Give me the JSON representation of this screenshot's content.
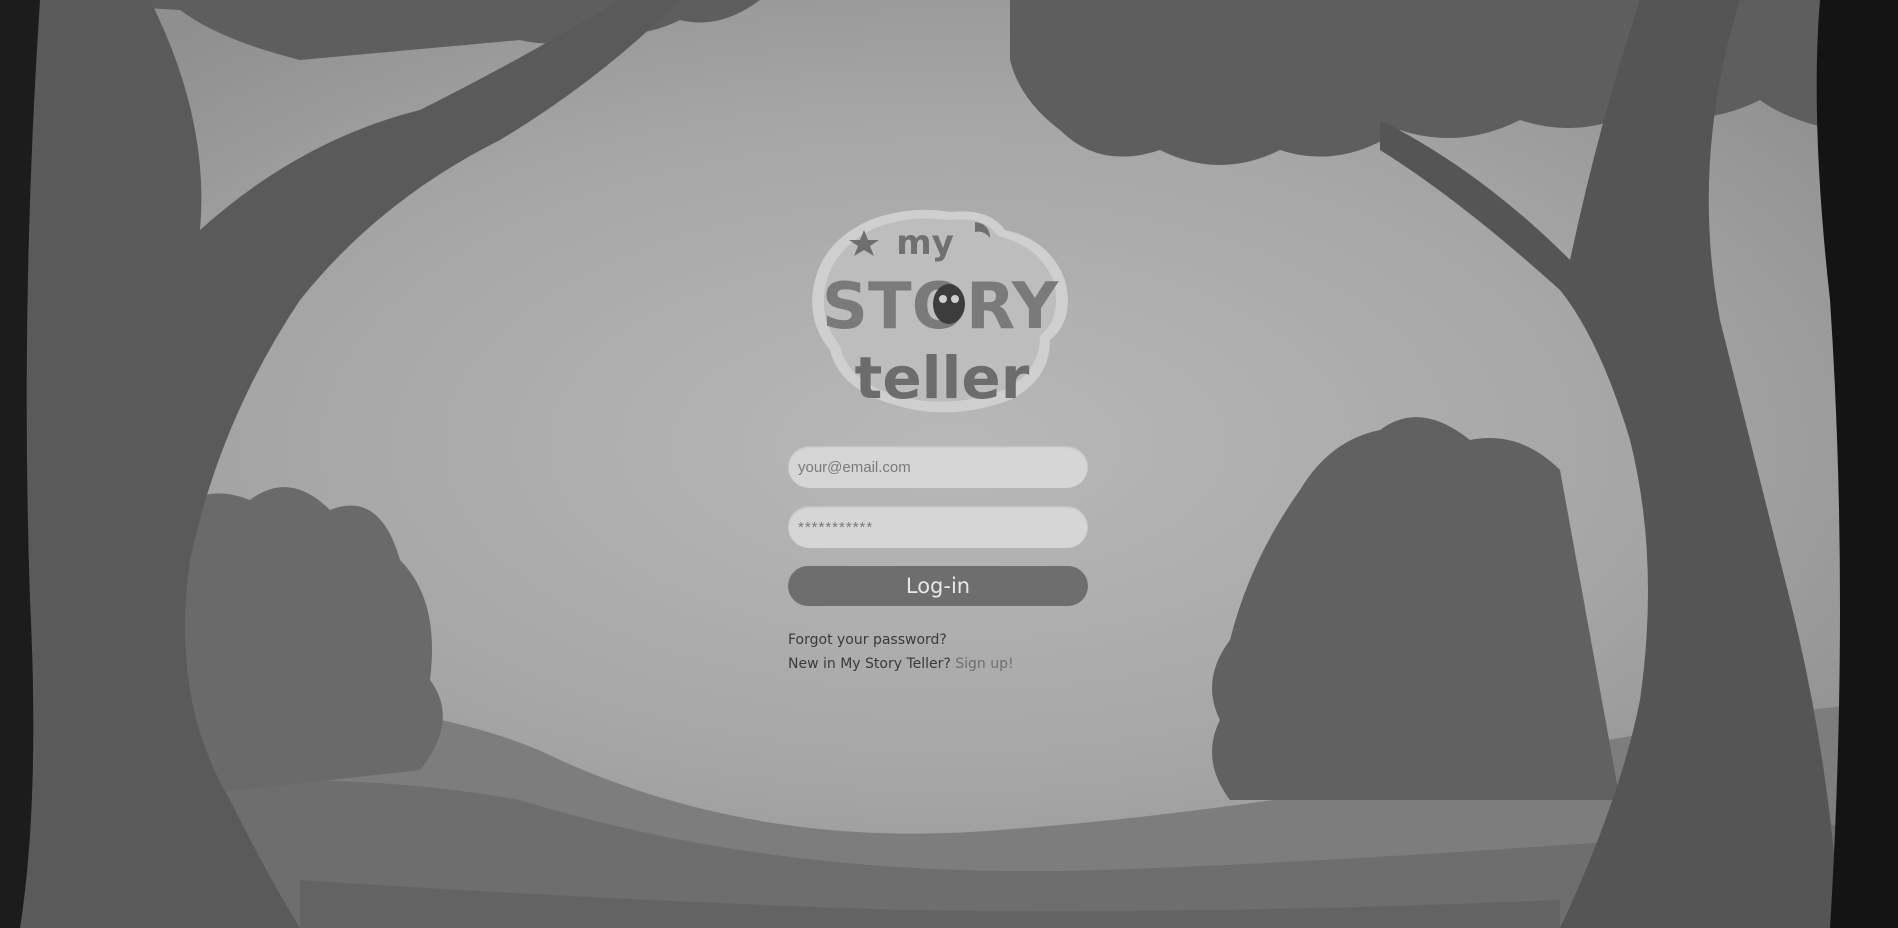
{
  "app": {
    "logo_text": {
      "line1": "my",
      "line2": "STORY",
      "line3": "teller"
    }
  },
  "login_form": {
    "email": {
      "placeholder": "your@email.com"
    },
    "password": {
      "placeholder": "***********"
    },
    "submit_label": "Log-in"
  },
  "links": {
    "forgot_password": "Forgot your password?",
    "signup_prompt": "New in My Story Teller?",
    "signup_link": "Sign up!"
  },
  "colors": {
    "sky": "#a9a9a9",
    "foliage": "#616161",
    "input_background": "#d6d6d6",
    "button_background": "#6e6e6e",
    "button_text": "#e8e8e8"
  }
}
